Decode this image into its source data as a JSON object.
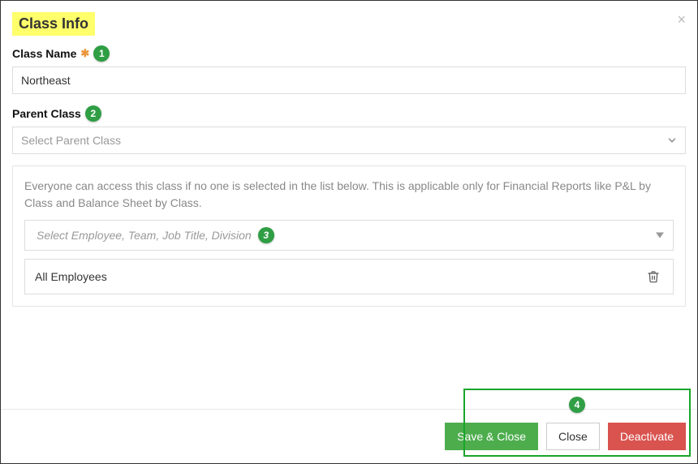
{
  "header": {
    "title": "Class Info"
  },
  "fields": {
    "class_name": {
      "label": "Class Name",
      "value": "Northeast",
      "step_badge": "1"
    },
    "parent_class": {
      "label": "Parent Class",
      "placeholder": "Select Parent Class",
      "step_badge": "2"
    }
  },
  "access": {
    "help_text": "Everyone can access this class if no one is selected in the list below. This is applicable only for Financial Reports like P&L by Class and Balance Sheet by Class.",
    "select_placeholder": "Select Employee, Team, Job Title, Division",
    "step_badge": "3",
    "rows": [
      {
        "label": "All Employees"
      }
    ]
  },
  "footer": {
    "save_close_label": "Save & Close",
    "close_label": "Close",
    "deactivate_label": "Deactivate",
    "step_badge": "4"
  }
}
